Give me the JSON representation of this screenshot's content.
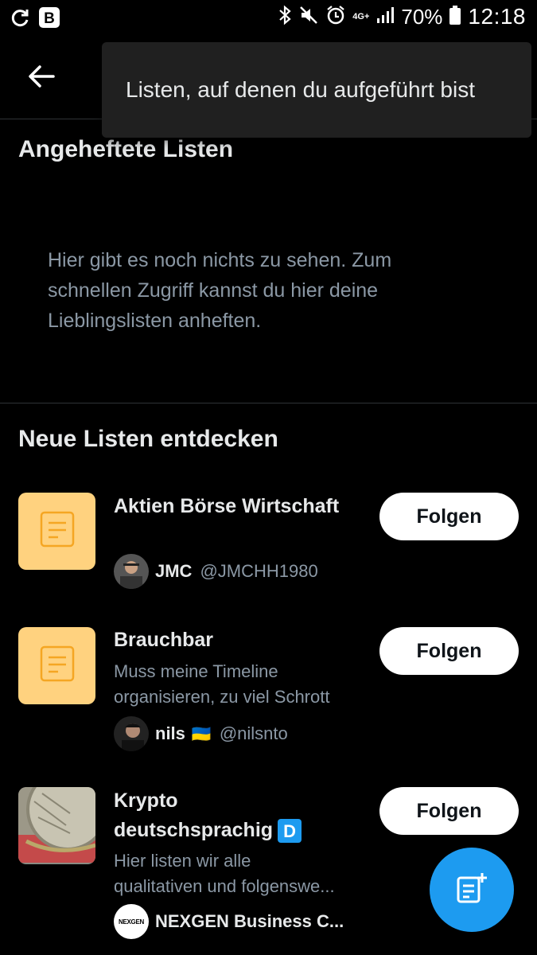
{
  "status_bar": {
    "battery_percent": "70%",
    "time": "12:18",
    "network": "4G+"
  },
  "menu": {
    "item_label": "Listen, auf denen du aufgeführt bist"
  },
  "pinned": {
    "title": "Angeheftete Listen",
    "empty_message": "Hier gibt es noch nichts zu sehen. Zum schnellen Zugriff kannst du hier deine Lieblingslisten anheften."
  },
  "discover": {
    "title": "Neue Listen entdecken",
    "follow_label": "Folgen",
    "items": [
      {
        "title": "Aktien Börse Wirtschaft",
        "description": "",
        "owner_name": "JMC",
        "owner_handle": "@JMCHH1980"
      },
      {
        "title": "Brauchbar",
        "description_line1": "Muss meine Timeline",
        "description_line2": "organisieren, zu viel Schrott",
        "owner_name": "nils",
        "owner_flag": "🇺🇦",
        "owner_handle": "@nilsnto"
      },
      {
        "title_line1": "Krypto",
        "title_line2": "deutschsprachig",
        "title_badge": "D",
        "description_line1": "Hier listen wir alle",
        "description_line2": "qualitativen und folgenswe...",
        "owner_name": "NEXGEN Business C...",
        "avatar_text": "NEXGEN"
      }
    ]
  },
  "colors": {
    "accent": "#1d9bf0",
    "list_thumb": "#ffd27f",
    "secondary_text": "#8b98a5"
  }
}
